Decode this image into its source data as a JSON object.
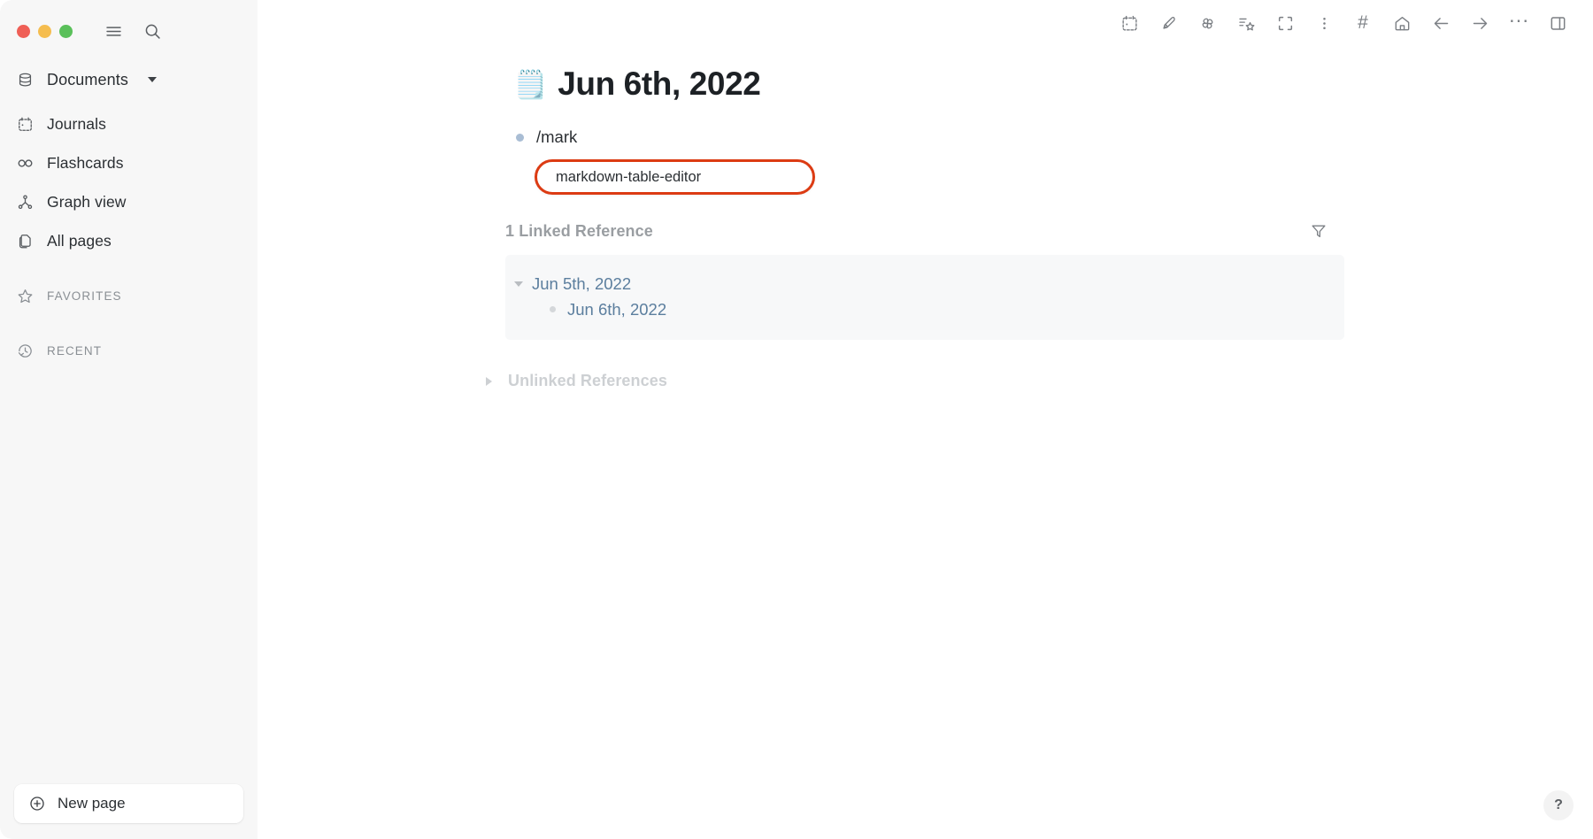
{
  "window": {
    "traffic_lights": [
      {
        "name": "close",
        "color": "#ef5f56"
      },
      {
        "name": "minimize",
        "color": "#f5bd4f"
      },
      {
        "name": "maximize",
        "color": "#5ac05a"
      }
    ]
  },
  "sidebar": {
    "top_icons": [
      {
        "name": "hamburger-menu-icon"
      },
      {
        "name": "search-icon"
      }
    ],
    "workspace": {
      "label": "Documents",
      "icon": "database-icon"
    },
    "items": [
      {
        "label": "Journals",
        "icon": "calendar-icon"
      },
      {
        "label": "Flashcards",
        "icon": "infinity-icon"
      },
      {
        "label": "Graph view",
        "icon": "graph-node-icon"
      },
      {
        "label": "All pages",
        "icon": "pages-copy-icon"
      }
    ],
    "sections": [
      {
        "label": "FAVORITES",
        "icon": "star-icon"
      },
      {
        "label": "RECENT",
        "icon": "history-clock-icon"
      }
    ],
    "new_page": {
      "label": "New page",
      "icon": "plus-circle-icon"
    }
  },
  "toolbar": {
    "icons": [
      {
        "name": "calendar-icon"
      },
      {
        "name": "pencil-edit-icon"
      },
      {
        "name": "pinwheel-icon"
      },
      {
        "name": "shooting-star-icon"
      },
      {
        "name": "fullscreen-icon"
      },
      {
        "name": "vertical-dots-icon"
      },
      {
        "name": "hashtag-icon",
        "glyph": "#"
      },
      {
        "name": "home-icon"
      },
      {
        "name": "back-arrow-icon"
      },
      {
        "name": "forward-arrow-icon"
      },
      {
        "name": "ellipsis-icon",
        "glyph": "···"
      },
      {
        "name": "right-sidebar-toggle-icon"
      }
    ]
  },
  "page": {
    "emoji": "🗒️",
    "title": "Jun 6th, 2022",
    "blocks": [
      {
        "text": "/mark"
      }
    ],
    "autocomplete": {
      "visible": true,
      "selected_item": "markdown-table-editor",
      "highlight_color": "#dc3b13"
    }
  },
  "linked_references": {
    "heading": "1 Linked Reference",
    "filter_icon": "funnel-filter-icon",
    "entries": [
      {
        "label": "Jun 5th, 2022",
        "expanded": true,
        "children": [
          {
            "label": "Jun 6th, 2022"
          }
        ]
      }
    ]
  },
  "unlinked_references": {
    "heading": "Unlinked References",
    "expanded": false
  },
  "help": {
    "label": "?"
  }
}
